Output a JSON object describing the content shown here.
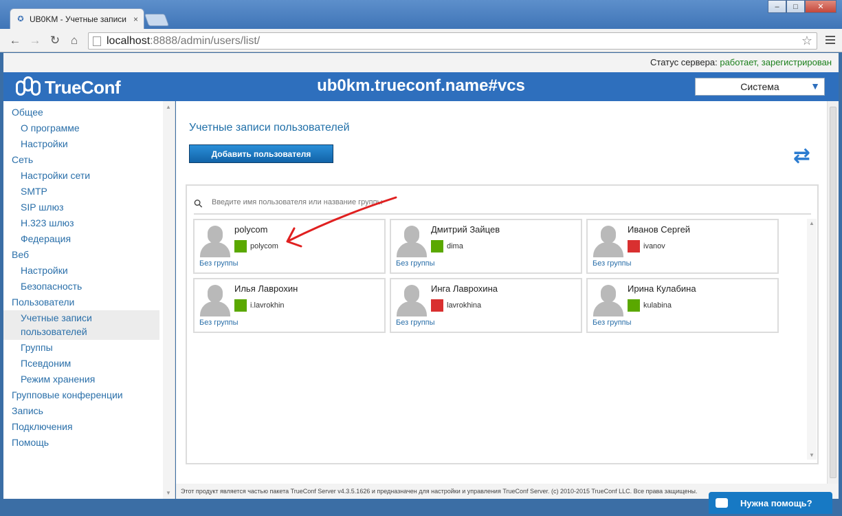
{
  "browser": {
    "tab_title": "UB0KM - Учетные записи",
    "tab_close": "×",
    "url_host": "localhost",
    "url_rest": ":8888/admin/users/list/",
    "win_min": "–",
    "win_max": "□",
    "win_close": "✕"
  },
  "status": {
    "label": "Статус сервера: ",
    "value": "работает, зарегистрирован"
  },
  "header": {
    "logo_text": "TrueConf",
    "server_name": "ub0km.trueconf.name#vcs",
    "system_select": "Система"
  },
  "sidebar": {
    "items": [
      {
        "label": "Общее"
      },
      {
        "label": "О программе"
      },
      {
        "label": "Настройки"
      },
      {
        "label": "Сеть"
      },
      {
        "label": "Настройки сети"
      },
      {
        "label": "SMTP"
      },
      {
        "label": "SIP шлюз"
      },
      {
        "label": "H.323 шлюз"
      },
      {
        "label": "Федерация"
      },
      {
        "label": "Веб"
      },
      {
        "label": "Настройки"
      },
      {
        "label": "Безопасность"
      },
      {
        "label": "Пользователи"
      },
      {
        "label": "Учетные записи пользователей"
      },
      {
        "label": "Группы"
      },
      {
        "label": "Псевдоним"
      },
      {
        "label": "Режим хранения"
      },
      {
        "label": "Групповые конференции"
      },
      {
        "label": "Запись"
      },
      {
        "label": "Подключения"
      },
      {
        "label": "Помощь"
      }
    ]
  },
  "main": {
    "title": "Учетные записи пользователей",
    "add_button": "Добавить пользователя",
    "search_placeholder": "Введите имя пользователя или название группы",
    "users": [
      {
        "name": "polycom",
        "login": "polycom",
        "group": "Без группы",
        "status_color": "#5aa800"
      },
      {
        "name": "Дмитрий Зайцев",
        "login": "dima",
        "group": "Без группы",
        "status_color": "#5aa800"
      },
      {
        "name": "Иванов Сергей",
        "login": "ivanov",
        "group": "Без группы",
        "status_color": "#d93030"
      },
      {
        "name": "Илья Лаврохин",
        "login": "i.lavrokhin",
        "group": "Без группы",
        "status_color": "#5aa800"
      },
      {
        "name": "Инга Лаврохина",
        "login": "lavrokhina",
        "group": "Без группы",
        "status_color": "#d93030"
      },
      {
        "name": "Ирина Кулабина",
        "login": "kulabina",
        "group": "Без группы",
        "status_color": "#5aa800"
      }
    ]
  },
  "footer": {
    "text": "Этот продукт является частью пакета TrueConf Server v4.3.5.1626 и предназначен для настройки и управления TrueConf Server. (c) 2010-2015 TrueConf LLC. Все права защищены."
  },
  "help": {
    "label": "Нужна помощь?"
  },
  "colors": {
    "brand_blue": "#2e6fbd",
    "link": "#2a6fa9",
    "online": "#5aa800",
    "offline": "#d93030",
    "annotation": "#e02020"
  },
  "icons": [
    "back-arrow-icon",
    "forward-arrow-icon",
    "reload-icon",
    "home-icon",
    "star-icon",
    "menu-icon",
    "search-icon",
    "refresh-icon",
    "chat-icon",
    "user-avatar-icon"
  ]
}
